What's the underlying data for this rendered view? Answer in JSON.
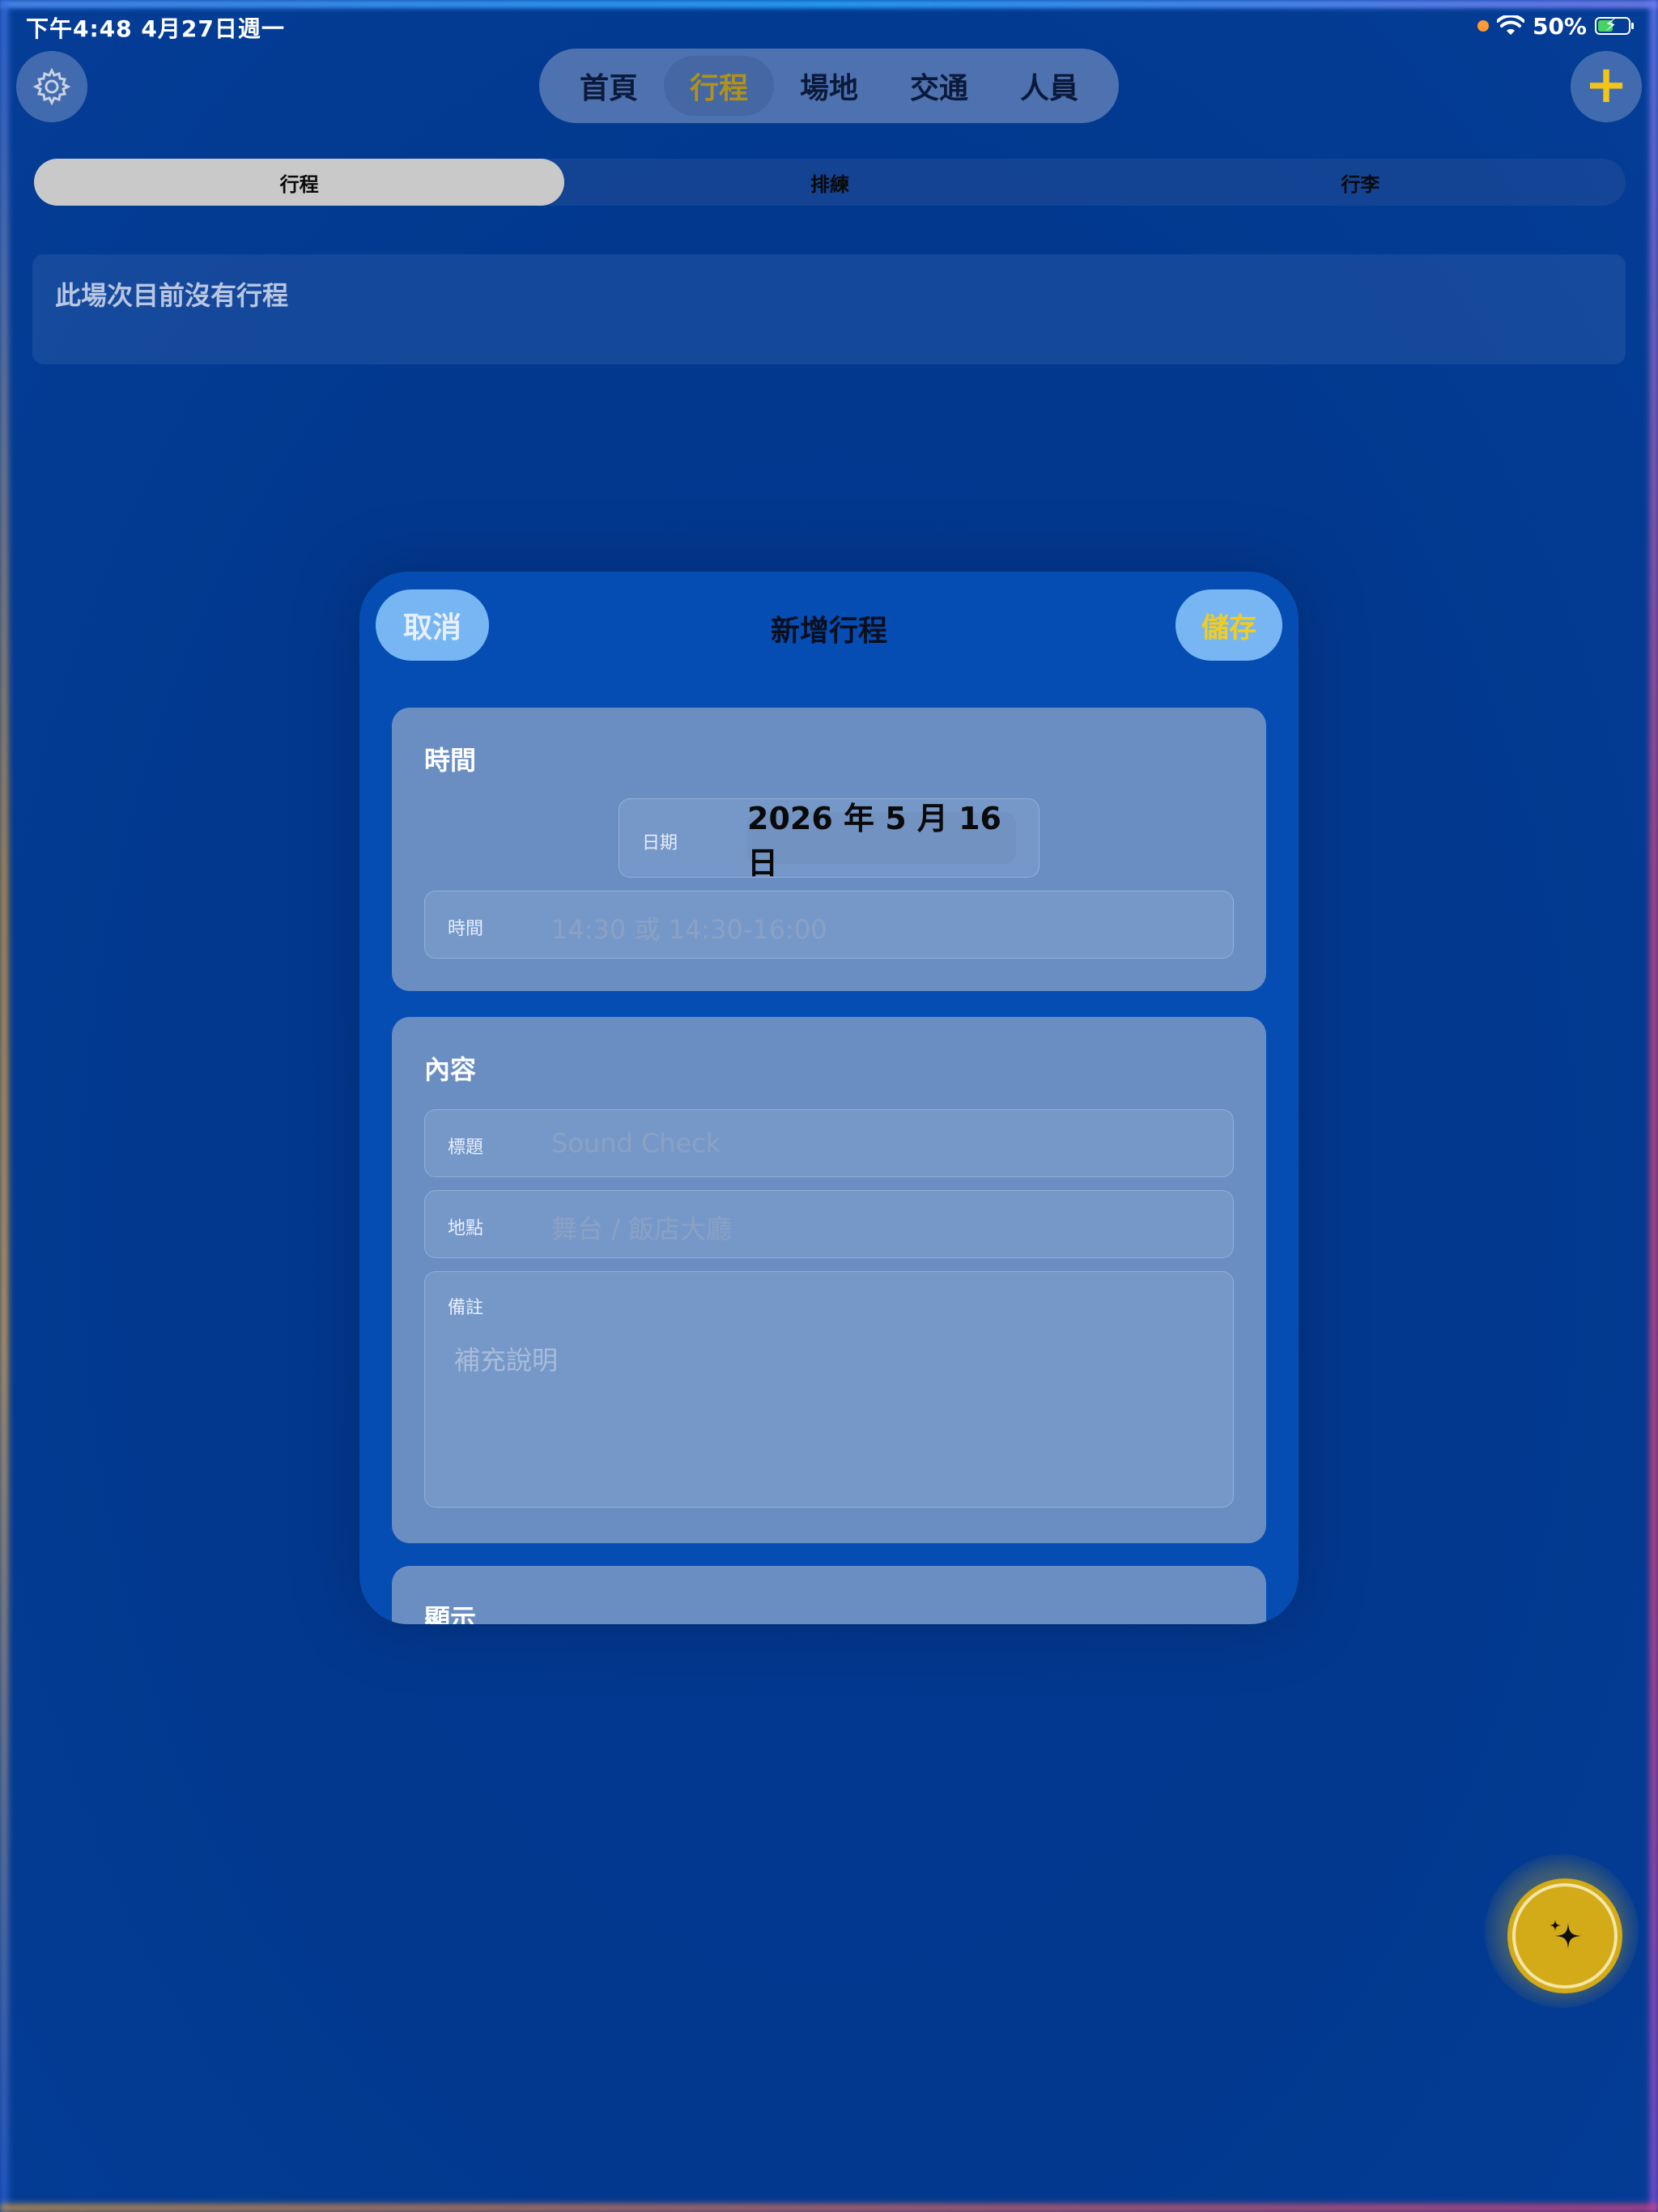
{
  "status_bar": {
    "time_date": "下午4:48   4月27日週一",
    "battery": "50%",
    "battery_level": 0.5
  },
  "top_tabs": {
    "items": [
      {
        "label": "首頁",
        "active": false
      },
      {
        "label": "行程",
        "active": true
      },
      {
        "label": "場地",
        "active": false
      },
      {
        "label": "交通",
        "active": false
      },
      {
        "label": "人員",
        "active": false
      }
    ]
  },
  "segment": {
    "items": [
      {
        "label": "行程",
        "active": true
      },
      {
        "label": "排練",
        "active": false
      },
      {
        "label": "行李",
        "active": false
      }
    ]
  },
  "empty_state": "此場次目前沒有行程",
  "modal": {
    "title": "新增行程",
    "cancel_label": "取消",
    "save_label": "儲存",
    "time_section": {
      "title": "時間",
      "date_label": "日期",
      "date_value": "2026 年 5 月 16 日",
      "time_label": "時間",
      "time_placeholder": "14:30 或 14:30-16:00"
    },
    "content_section": {
      "title": "內容",
      "title_label": "標題",
      "title_placeholder": "Sound Check",
      "location_label": "地點",
      "location_placeholder": "舞台 / 飯店大廳",
      "notes_label": "備註",
      "notes_placeholder": "補充說明"
    },
    "display_section": {
      "title": "顯示"
    }
  },
  "colors": {
    "background": "#02398f",
    "accent_yellow": "#f2c418",
    "modal_background": "#054db3",
    "section_background": "#6a8ec2"
  },
  "icons": {
    "settings": "gear-icon",
    "add": "plus-icon",
    "ai": "sparkles-icon",
    "wifi": "wifi-icon",
    "battery": "battery-charging-icon"
  }
}
